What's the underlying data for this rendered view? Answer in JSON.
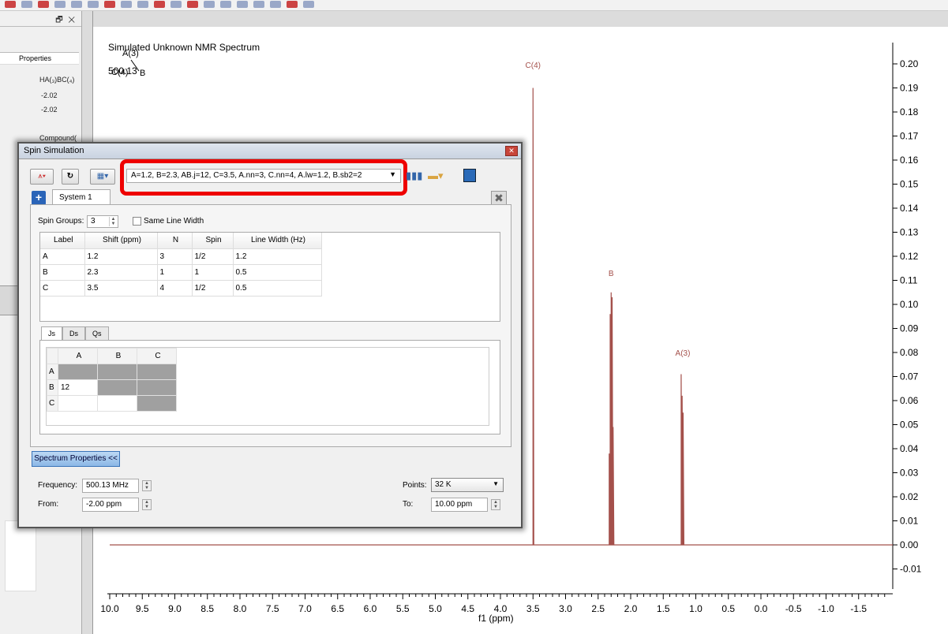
{
  "left_panel": {
    "float_close": "🗗 ✕",
    "properties_header": "Properties",
    "formula": "HA(₃)BC(₄)",
    "value1": "-2.02",
    "value2": "-2.02",
    "compound": "Compound("
  },
  "spectrum": {
    "title": "Simulated Unknown NMR Spectrum",
    "frequency_text": "500.13",
    "struct_labels": {
      "a3": "A(3)",
      "c4": "C(4)",
      "b": "B"
    },
    "peak_labels": [
      {
        "label": "C(4)",
        "ppm": 3.5
      },
      {
        "label": "B",
        "ppm": 2.3
      },
      {
        "label": "A(3)",
        "ppm": 1.2
      }
    ],
    "x_axis": {
      "label": "f1 (ppm)",
      "ticks": [
        "10.0",
        "9.5",
        "9.0",
        "8.5",
        "8.0",
        "7.5",
        "7.0",
        "6.5",
        "6.0",
        "5.5",
        "5.0",
        "4.5",
        "4.0",
        "3.5",
        "3.0",
        "2.5",
        "2.0",
        "1.5",
        "1.0",
        "0.5",
        "0.0",
        "-0.5",
        "-1.0",
        "-1.5"
      ],
      "tick_values": [
        10.0,
        9.5,
        9.0,
        8.5,
        8.0,
        7.5,
        7.0,
        6.5,
        6.0,
        5.5,
        5.0,
        4.5,
        4.0,
        3.5,
        3.0,
        2.5,
        2.0,
        1.5,
        1.0,
        0.5,
        0.0,
        -0.5,
        -1.0,
        -1.5
      ]
    },
    "y_axis": {
      "ticks": [
        "0.20",
        "0.19",
        "0.18",
        "0.17",
        "0.16",
        "0.15",
        "0.14",
        "0.13",
        "0.12",
        "0.11",
        "0.10",
        "0.09",
        "0.08",
        "0.07",
        "0.06",
        "0.05",
        "0.04",
        "0.03",
        "0.02",
        "0.01",
        "0.00",
        "-0.01"
      ],
      "tick_values": [
        0.2,
        0.19,
        0.18,
        0.17,
        0.16,
        0.15,
        0.14,
        0.13,
        0.12,
        0.11,
        0.1,
        0.09,
        0.08,
        0.07,
        0.06,
        0.05,
        0.04,
        0.03,
        0.02,
        0.01,
        0.0,
        -0.01
      ]
    },
    "line_color": "#a4504b"
  },
  "dialog": {
    "title": "Spin Simulation",
    "preset": "A=1.2, B=2.3, AB.j=12, C=3.5, A.nn=3, C.nn=4, A.lw=1.2, B.sb2=2",
    "system_tab": "System 1",
    "spin_groups_label": "Spin Groups:",
    "spin_groups_value": "3",
    "same_line_width": "Same Line Width",
    "columns": [
      "Label",
      "Shift (ppm)",
      "N",
      "Spin",
      "Line Width (Hz)"
    ],
    "rows": [
      [
        "A",
        "1.2",
        "3",
        "1/2",
        "1.2"
      ],
      [
        "B",
        "2.3",
        "1",
        "1",
        "0.5"
      ],
      [
        "C",
        "3.5",
        "4",
        "1/2",
        "0.5"
      ]
    ],
    "tabs": [
      "Js",
      "Ds",
      "Qs"
    ],
    "j_headers": [
      "A",
      "B",
      "C"
    ],
    "j_rows": [
      [
        "A",
        "",
        ""
      ],
      [
        "B",
        "12",
        ""
      ],
      [
        "C",
        "",
        ""
      ]
    ],
    "spectrum_properties_btn": "Spectrum Properties <<",
    "frequency_label": "Frequency:",
    "frequency_value": "500.13 MHz",
    "from_label": "From:",
    "from_value": "-2.00 ppm",
    "points_label": "Points:",
    "points_value": "32 K",
    "to_label": "To:",
    "to_value": "10.00 ppm"
  }
}
